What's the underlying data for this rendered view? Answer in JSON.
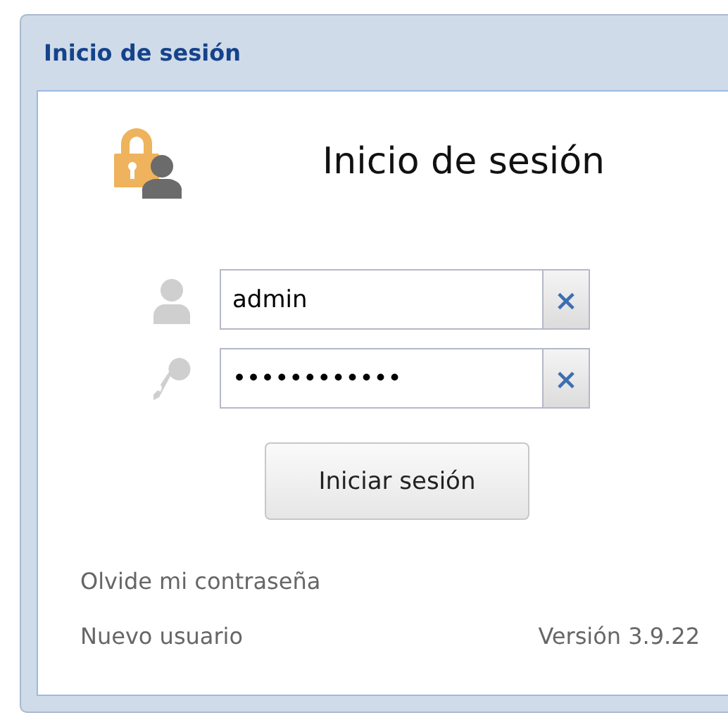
{
  "window": {
    "title": "Inicio de sesión"
  },
  "heading": "Inicio de sesión",
  "fields": [
    {
      "kind": "user",
      "value": "admin",
      "clear": "×"
    },
    {
      "kind": "key",
      "value": "••••••••••••",
      "clear": "×"
    }
  ],
  "button": "Iniciar sesión",
  "links": [
    "Olvide mi contraseña",
    "Nuevo usuario"
  ],
  "version": "Versión 3.9.22"
}
